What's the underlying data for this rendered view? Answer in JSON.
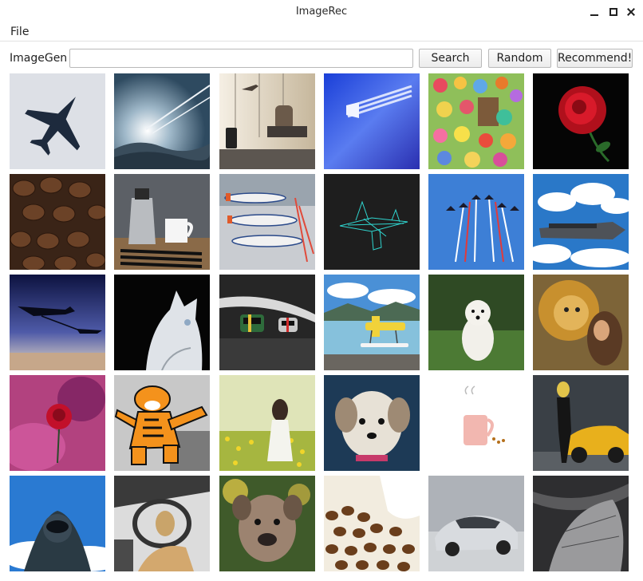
{
  "window": {
    "title": "ImageRec"
  },
  "menu": {
    "file_label": "File"
  },
  "toolbar": {
    "label": "ImageGen",
    "input_value": "",
    "search_label": "Search",
    "random_label": "Random",
    "recommend_label": "Recommend!"
  },
  "images": [
    {
      "subject": "fighter-jet"
    },
    {
      "subject": "contrails-sky"
    },
    {
      "subject": "airport-traveler"
    },
    {
      "subject": "blue-jet-blur"
    },
    {
      "subject": "cartoon-collage"
    },
    {
      "subject": "red-rose"
    },
    {
      "subject": "coffee-beans"
    },
    {
      "subject": "coffee-pot-mug"
    },
    {
      "subject": "airport-planes"
    },
    {
      "subject": "wireframe-plane"
    },
    {
      "subject": "jets-formation"
    },
    {
      "subject": "sky-ship"
    },
    {
      "subject": "refueling-planes"
    },
    {
      "subject": "white-cat"
    },
    {
      "subject": "race-cars"
    },
    {
      "subject": "seaplane-lake"
    },
    {
      "subject": "white-puppy"
    },
    {
      "subject": "lion-woman"
    },
    {
      "subject": "pink-rose-smoke"
    },
    {
      "subject": "cartoon-tiger"
    },
    {
      "subject": "woman-field"
    },
    {
      "subject": "shaggy-dog"
    },
    {
      "subject": "pink-mug"
    },
    {
      "subject": "woman-sportscar"
    },
    {
      "subject": "cockpit-pilot"
    },
    {
      "subject": "car-interior"
    },
    {
      "subject": "bulldog"
    },
    {
      "subject": "coffee-beans-cup"
    },
    {
      "subject": "silver-car"
    },
    {
      "subject": "old-aircraft"
    }
  ]
}
